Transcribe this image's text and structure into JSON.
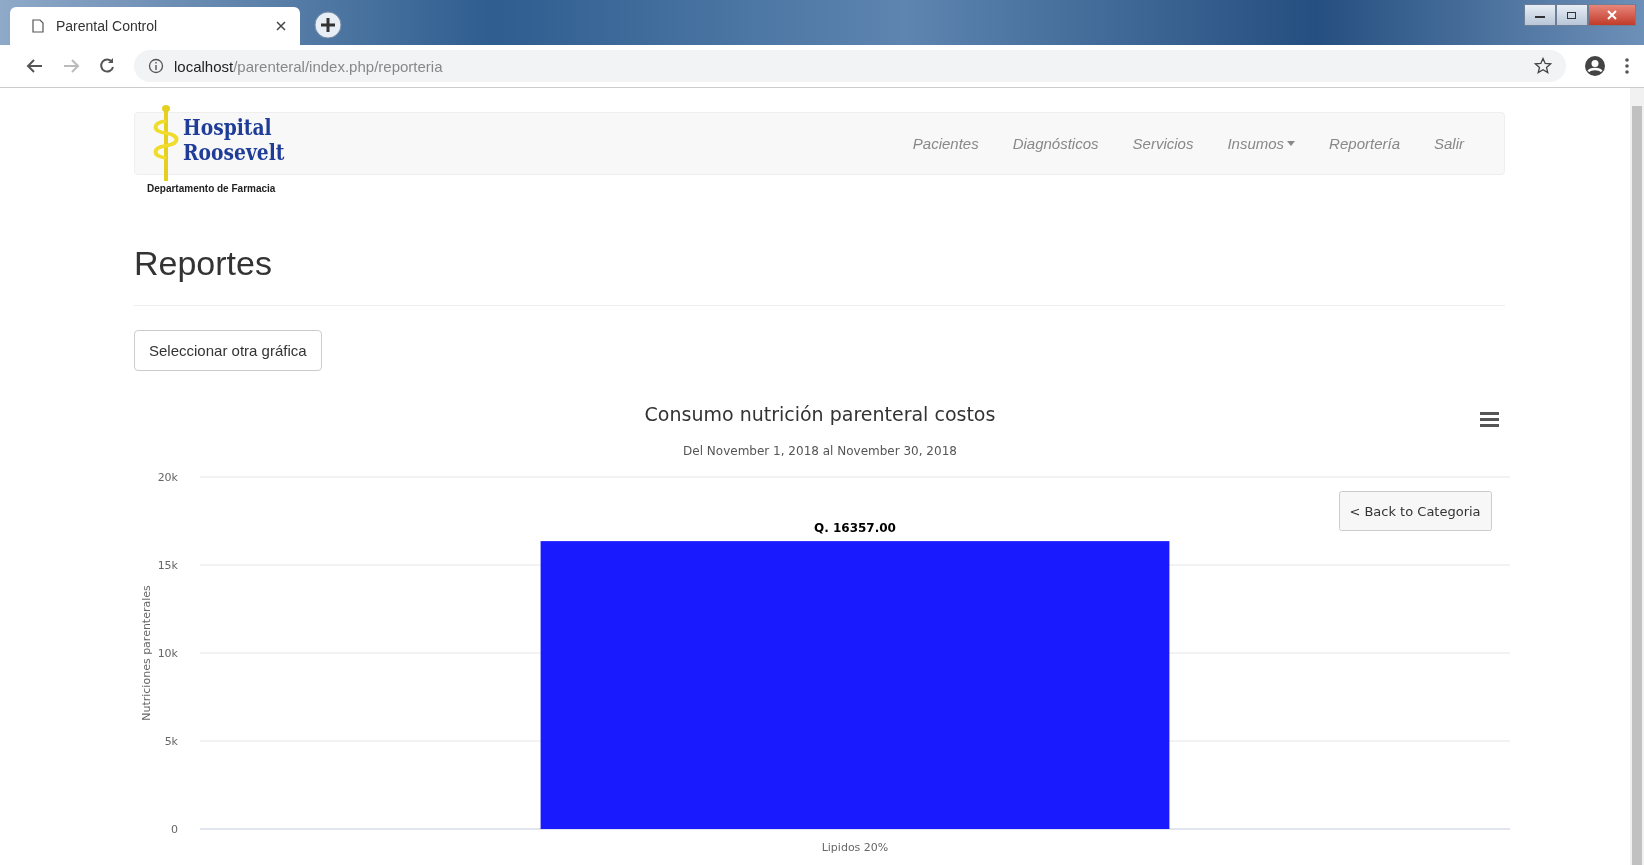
{
  "browser": {
    "tab_title": "Parental Control",
    "url_host": "localhost",
    "url_path": "/parenteral/index.php/reporteria"
  },
  "logo": {
    "line1": "Hospital",
    "line2": "Roosevelt",
    "subtitle": "Departamento de Farmacia"
  },
  "nav": [
    {
      "label": "Pacientes",
      "dropdown": false
    },
    {
      "label": "Diagnósticos",
      "dropdown": false
    },
    {
      "label": "Servicios",
      "dropdown": false
    },
    {
      "label": "Insumos",
      "dropdown": true
    },
    {
      "label": "Reportería",
      "dropdown": false
    },
    {
      "label": "Salir",
      "dropdown": false
    }
  ],
  "page_title": "Reportes",
  "select_button": "Seleccionar otra gráfica",
  "back_button": "< Back to Categoria",
  "chart": {
    "subtitle": "Del November 1, 2018 al November 30, 2018",
    "chart_data": {
      "type": "bar",
      "title": "Consumo nutrición parenteral costos",
      "ylabel": "Nutriciones parenterales",
      "categories": [
        "Lipidos 20%"
      ],
      "series": [
        {
          "color": "#1a1aff",
          "values": [
            16357
          ]
        }
      ],
      "grid": true,
      "ylim": [
        0,
        20000
      ],
      "yticks": [
        {
          "value": 0,
          "label": "0"
        },
        {
          "value": 5000,
          "label": "5k"
        },
        {
          "value": 10000,
          "label": "10k"
        },
        {
          "value": 15000,
          "label": "15k"
        },
        {
          "value": 20000,
          "label": "20k"
        }
      ],
      "value_labels": [
        "Q. 16357.00"
      ]
    }
  }
}
